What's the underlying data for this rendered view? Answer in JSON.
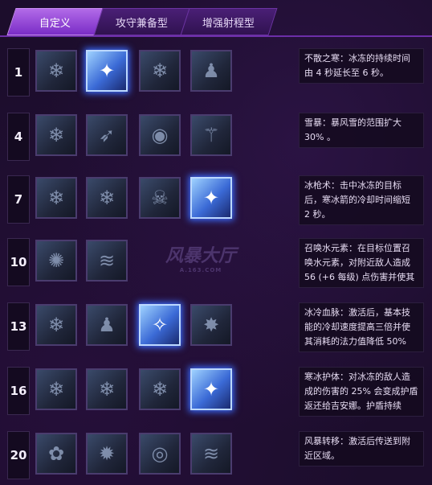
{
  "tabs": [
    {
      "label": "自定义",
      "active": true
    },
    {
      "label": "攻守兼备型",
      "active": false
    },
    {
      "label": "增强射程型",
      "active": false
    }
  ],
  "watermark": {
    "title": "风暴大厅",
    "sub": "A.163.COM"
  },
  "rows": [
    {
      "level": "1",
      "selected": 1,
      "icons": [
        "frost-shard-icon",
        "ice-crystal-icon",
        "frost-shard-icon",
        "frost-figure-icon"
      ],
      "desc": "不散之寒：冰冻的持续时间由 4 秒延长至 6 秒。"
    },
    {
      "level": "4",
      "selected": -1,
      "icons": [
        "frost-shard-icon",
        "ice-spear-icon",
        "frost-eye-icon",
        "frost-staff-icon"
      ],
      "desc": "雪暴：暴风雪的范围扩大 30% 。"
    },
    {
      "level": "7",
      "selected": 3,
      "icons": [
        "frost-shard-icon",
        "frost-shard-icon",
        "skull-icon",
        "ice-crystal-icon"
      ],
      "desc": "冰枪术：击中冰冻的目标后，寒冰箭的冷却时间缩短 2 秒。"
    },
    {
      "level": "10",
      "selected": -1,
      "icons": [
        "water-elemental-icon",
        "ice-wave-icon"
      ],
      "desc": "召唤水元素：在目标位置召唤水元素，对附近敌人造成 56 (+6 每级) 点伤害并使其"
    },
    {
      "level": "13",
      "selected": 2,
      "icons": [
        "frost-shard-icon",
        "frost-figure-icon",
        "ice-lance-icon",
        "claw-icon"
      ],
      "desc": "冰冷血脉：激活后，基本技能的冷却速度提高三倍并使其消耗的法力值降低 50%"
    },
    {
      "level": "16",
      "selected": 3,
      "icons": [
        "frost-shard-icon",
        "frost-shard-icon",
        "frost-shard-icon",
        "ice-crystal-icon"
      ],
      "desc": "寒冰护体：对冰冻的敌人造成的伤害的 25% 会变成护盾返还给吉安娜。护盾持续"
    },
    {
      "level": "20",
      "selected": -1,
      "icons": [
        "pink-mist-icon",
        "blink-icon",
        "frost-orb-icon",
        "ice-wave-icon"
      ],
      "desc": "风暴转移：激活后传送到附近区域。"
    }
  ]
}
